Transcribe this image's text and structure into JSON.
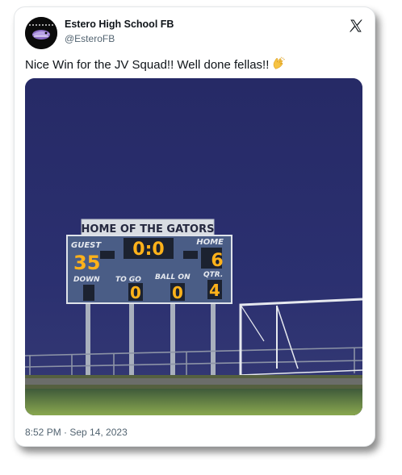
{
  "account": {
    "name": "Estero High School FB",
    "handle": "@EsteroFB"
  },
  "tweet": {
    "text": "Nice Win for the JV Squad!! Well done fellas!!",
    "emoji_icon": "clapping-hands-icon",
    "timestamp": "8:52 PM · Sep 14, 2023"
  },
  "brand": {
    "platform_icon": "x-logo-icon"
  },
  "photo": {
    "scoreboard": {
      "banner": "HOME OF THE GATORS",
      "guest_label": "GUEST",
      "home_label": "HOME",
      "guest_score": "35",
      "home_score": "6",
      "clock": "0:0",
      "down_label": "DOWN",
      "to_go_label": "TO GO",
      "ball_on_label": "BALL ON",
      "qtr_label": "QTR.",
      "to_go_value": "0",
      "ball_on_value": "0",
      "qtr_value": "4"
    }
  },
  "colors": {
    "text_primary": "#0f1419",
    "text_secondary": "#536471",
    "digit": "#ffb21a",
    "sky": "#2a2f6b"
  }
}
